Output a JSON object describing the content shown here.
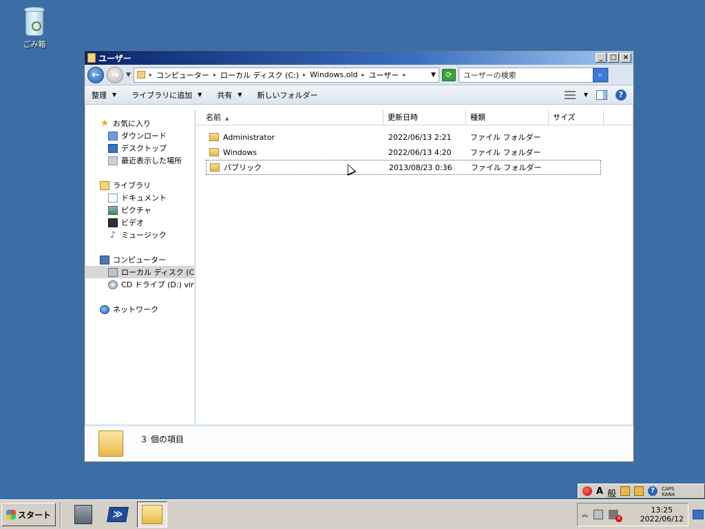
{
  "desktop": {
    "recycle_bin_label": "ごみ箱"
  },
  "window": {
    "title": "ユーザー",
    "controls": {
      "minimize": "_",
      "maximize": "□",
      "close": "×"
    }
  },
  "address": {
    "crumbs": [
      "コンピューター",
      "ローカル ディスク (C:)",
      "Windows.old",
      "ユーザー"
    ],
    "search_placeholder": "ユーザーの検索"
  },
  "toolbar": {
    "organize": "整理",
    "add_to_library": "ライブラリに追加",
    "share": "共有",
    "new_folder": "新しいフォルダー"
  },
  "nav": {
    "favorites": {
      "label": "お気に入り",
      "items": [
        "ダウンロード",
        "デスクトップ",
        "最近表示した場所"
      ]
    },
    "libraries": {
      "label": "ライブラリ",
      "items": [
        "ドキュメント",
        "ピクチャ",
        "ビデオ",
        "ミュージック"
      ]
    },
    "computer": {
      "label": "コンピューター",
      "items": [
        "ローカル ディスク (C:)",
        "CD ドライブ (D:) virtio"
      ]
    },
    "network": {
      "label": "ネットワーク"
    }
  },
  "columns": {
    "name": "名前",
    "date": "更新日時",
    "type": "種類",
    "size": "サイズ"
  },
  "files": [
    {
      "name": "Administrator",
      "date": "2022/06/13 2:21",
      "type": "ファイル フォルダー"
    },
    {
      "name": "Windows",
      "date": "2022/06/13 4:20",
      "type": "ファイル フォルダー"
    },
    {
      "name": "パブリック",
      "date": "2013/08/23 0:36",
      "type": "ファイル フォルダー"
    }
  ],
  "details": {
    "item_count": "３ 個の項目"
  },
  "langbar": {
    "a": "A",
    "mode": "般",
    "caps_top": "CAPS",
    "caps_bottom": "KANA"
  },
  "taskbar": {
    "start_label": "スタート",
    "clock_time": "13:25",
    "clock_date": "2022/06/12"
  }
}
